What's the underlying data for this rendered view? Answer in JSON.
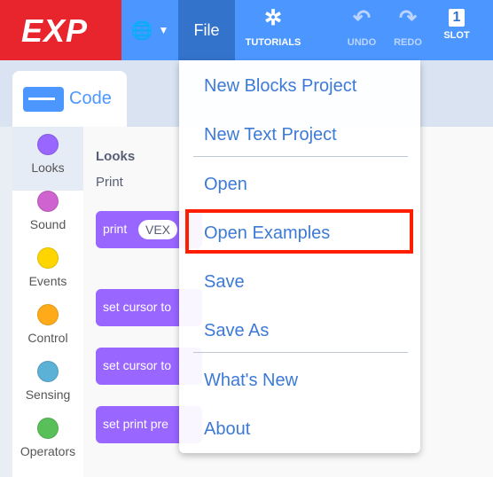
{
  "app": {
    "logo_text": "EXP",
    "file_label": "File",
    "toolbar": {
      "tutorials": "TUTORIALS",
      "undo": "UNDO",
      "redo": "REDO",
      "slot": "SLOT",
      "slot_number": "1"
    }
  },
  "tab": {
    "label": "Code"
  },
  "categories": [
    {
      "label": "Looks",
      "color": "#9966ff"
    },
    {
      "label": "Sound",
      "color": "#cf63cf"
    },
    {
      "label": "Events",
      "color": "#ffd500"
    },
    {
      "label": "Control",
      "color": "#ffab19"
    },
    {
      "label": "Sensing",
      "color": "#5cb1d6"
    },
    {
      "label": "Operators",
      "color": "#59c059"
    }
  ],
  "workspace": {
    "section_title": "Looks",
    "section_subtitle": "Print",
    "blocks": [
      {
        "label": "print",
        "arg": "VEX"
      },
      {
        "label": "set cursor to",
        "arg": ""
      },
      {
        "label": "set cursor to",
        "arg": ""
      },
      {
        "label": "set print pre",
        "arg": ""
      }
    ]
  },
  "file_menu": {
    "items": [
      "New Blocks Project",
      "New Text Project",
      "Open",
      "Open Examples",
      "Save",
      "Save As",
      "What's New",
      "About"
    ]
  }
}
